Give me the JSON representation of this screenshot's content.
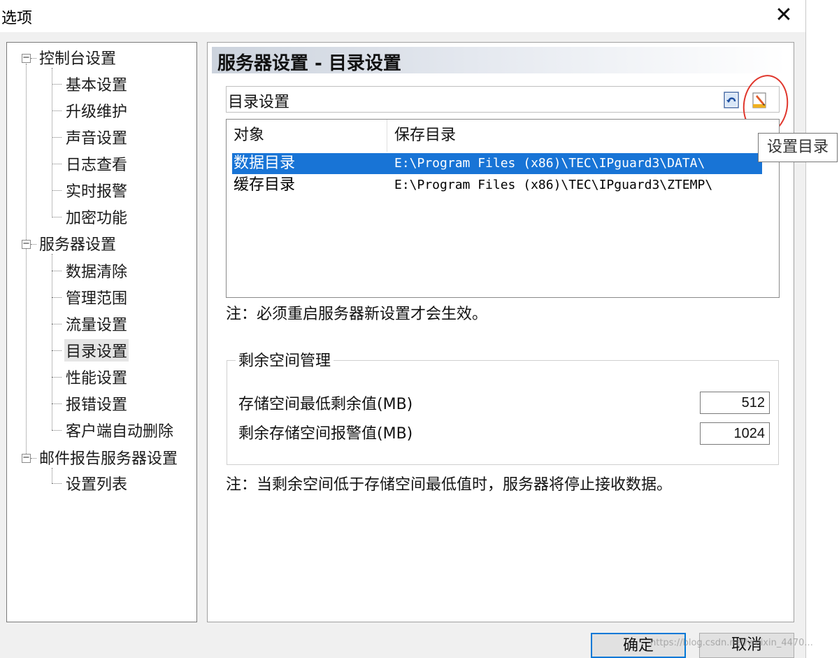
{
  "window": {
    "title": "选项",
    "close_glyph": "✕"
  },
  "tree": {
    "groups": [
      {
        "label": "控制台设置",
        "toggle": "−",
        "children": [
          "基本设置",
          "升级维护",
          "声音设置",
          "日志查看",
          "实时报警",
          "加密功能"
        ]
      },
      {
        "label": "服务器设置",
        "toggle": "−",
        "children": [
          "数据清除",
          "管理范围",
          "流量设置",
          "目录设置",
          "性能设置",
          "报错设置",
          "客户端自动删除"
        ]
      },
      {
        "label": "邮件报告服务器设置",
        "toggle": "−",
        "children": [
          "设置列表"
        ]
      }
    ],
    "selected": "目录设置"
  },
  "content": {
    "section_title": "服务器设置 - 目录设置",
    "dir_toolbar_label": "目录设置",
    "tooltip": "设置目录",
    "columns": {
      "object": "对象",
      "path": "保存目录"
    },
    "rows": [
      {
        "name": "数据目录",
        "path": "E:\\Program Files (x86)\\TEC\\IPguard3\\DATA\\"
      },
      {
        "name": "缓存目录",
        "path": "E:\\Program Files (x86)\\TEC\\IPguard3\\ZTEMP\\"
      }
    ],
    "restart_note": "注：必须重启服务器新设置才会生效。",
    "space_group_title": "剩余空间管理",
    "min_free_label": "存储空间最低剩余值(MB)",
    "min_free_value": "512",
    "alert_label": "剩余存储空间报警值(MB)",
    "alert_value": "1024",
    "space_note": "注：当剩余空间低于存储空间最低值时，服务器将停止接收数据。"
  },
  "buttons": {
    "ok": "确定",
    "cancel": "取消"
  },
  "watermark": "https://blog.csdn.net/weixin_4470..."
}
